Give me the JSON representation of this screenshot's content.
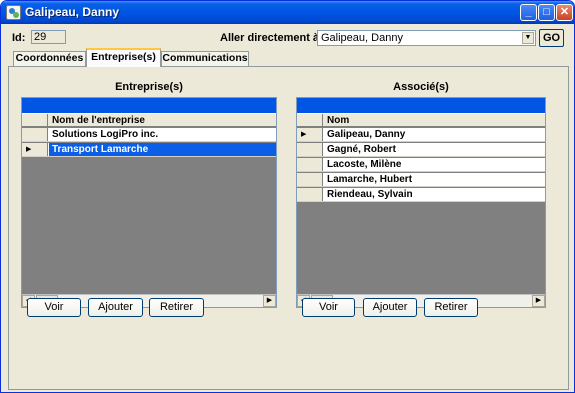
{
  "window": {
    "title": "Galipeau, Danny"
  },
  "header": {
    "id_label": "Id:",
    "id_value": "29",
    "goto_label": "Aller directement à :",
    "goto_value": "Galipeau,  Danny",
    "go_button": "GO"
  },
  "tabs": [
    {
      "label": "Coordonnées",
      "active": false
    },
    {
      "label": "Entreprise(s)",
      "active": true
    },
    {
      "label": "Communications",
      "active": false
    }
  ],
  "entreprises": {
    "title": "Entreprise(s)",
    "column": "Nom de l'entreprise",
    "rows": [
      "Solutions LogiPro inc.",
      "Transport Lamarche"
    ],
    "current_row": 1,
    "buttons": [
      "Voir",
      "Ajouter",
      "Retirer"
    ]
  },
  "associes": {
    "title": "Associé(s)",
    "column": "Nom",
    "rows": [
      "Galipeau, Danny",
      "Gagné, Robert",
      "Lacoste, Milène",
      "Lamarche, Hubert",
      "Riendeau, Sylvain"
    ],
    "current_row": 0,
    "buttons": [
      "Voir",
      "Ajouter",
      "Retirer"
    ]
  },
  "colors": {
    "titlebar": "#0055e5",
    "selection": "#0a5fe6",
    "window_bg": "#ece9d8",
    "grid_empty": "#808080"
  },
  "icons": {
    "row_pointer": "black-right-triangle",
    "scroll_left": "left-arrow",
    "scroll_right": "right-arrow",
    "dropdown": "down-arrow"
  }
}
